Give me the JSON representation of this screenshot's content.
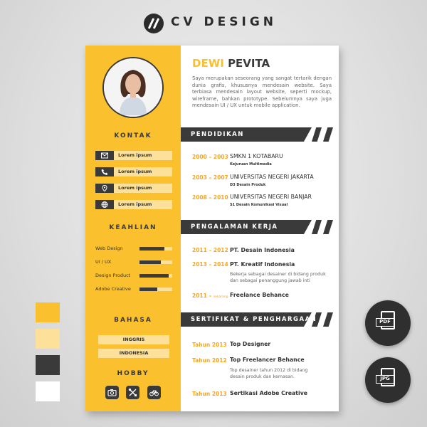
{
  "brand": {
    "title": "CV DESIGN"
  },
  "resume": {
    "first_name": "DEWI",
    "last_name": "PEVITA",
    "about": "Saya merupakan seseorang yang sangat tertarik dengan dunia grafis, khususnya mendesain website. Saya terbiasa mendesain layout website, seperti mockup, wireframe, bahkan prototype. Sebelumnya saya juga mendesain UI / UX untuk mobile application.",
    "kontak": {
      "title": "KONTAK",
      "items": [
        {
          "icon": "mail-icon",
          "label": "Lorem ipsum"
        },
        {
          "icon": "phone-icon",
          "label": "Lorem ipsum"
        },
        {
          "icon": "location-icon",
          "label": "Lorem ipsum"
        },
        {
          "icon": "globe-icon",
          "label": "Lorem ipsum"
        }
      ]
    },
    "keahlian": {
      "title": "KEAHLIAN",
      "items": [
        {
          "label": "Web Design",
          "level": 0.75
        },
        {
          "label": "UI / UX",
          "level": 0.65
        },
        {
          "label": "Design Product",
          "level": 0.9
        },
        {
          "label": "Adobe Creative",
          "level": 0.55
        }
      ]
    },
    "bahasa": {
      "title": "BAHASA",
      "items": [
        "INGGRIS",
        "INDONESIA"
      ]
    },
    "hobby": {
      "title": "HOBBY",
      "icons": [
        "camera-icon",
        "tools-icon",
        "bicycle-icon"
      ]
    },
    "pendidikan": {
      "title": "PENDIDIKAN",
      "items": [
        {
          "years": "2000 – 2003",
          "school": "SMKN 1 KOTABARU",
          "detail": "Kejuruan Multimedia"
        },
        {
          "years": "2003 – 2007",
          "school": "UNIVERSITAS NEGERI JAKARTA",
          "detail": "D3 Desain Produk"
        },
        {
          "years": "2008 – 2010",
          "school": "UNIVERSITAS NEGERI BANJAR",
          "detail": "S1 Desain Komunikasi Visual"
        }
      ]
    },
    "pengalaman": {
      "title": "PENGALAMAN KERJA",
      "items": [
        {
          "years": "2011 – 2012",
          "company": "PT. Desain Indonesia"
        },
        {
          "years": "2013 – 2014",
          "company": "PT. Kreatif Indonesia",
          "desc": "Bekerja sebagai desainer di bidang produk dan sebagai penanggung jawab inti"
        },
        {
          "years": "2011 –",
          "years_suffix": "sekarang",
          "company": "Freelance Behance"
        }
      ]
    },
    "sertifikat": {
      "title": "SERTIFIKAT & PENGHARGAAN",
      "items": [
        {
          "year": "Tahun 2013",
          "title": "Top Designer"
        },
        {
          "year": "Tahun 2012",
          "title": "Top Freelancer Behance",
          "desc": "Top desainer tahun 2012 di bidang desain produk dan kemasan."
        },
        {
          "year": "Tahun 2013",
          "title": "Sertikasi Adobe Creative"
        }
      ]
    }
  },
  "palette": [
    "#FBC02D",
    "#FDE19A",
    "#3a3a3a",
    "#ffffff"
  ],
  "badges": [
    {
      "icon": "pdf-file-icon",
      "label": "PDF"
    },
    {
      "icon": "jpg-file-icon",
      "label": "JPG"
    }
  ]
}
